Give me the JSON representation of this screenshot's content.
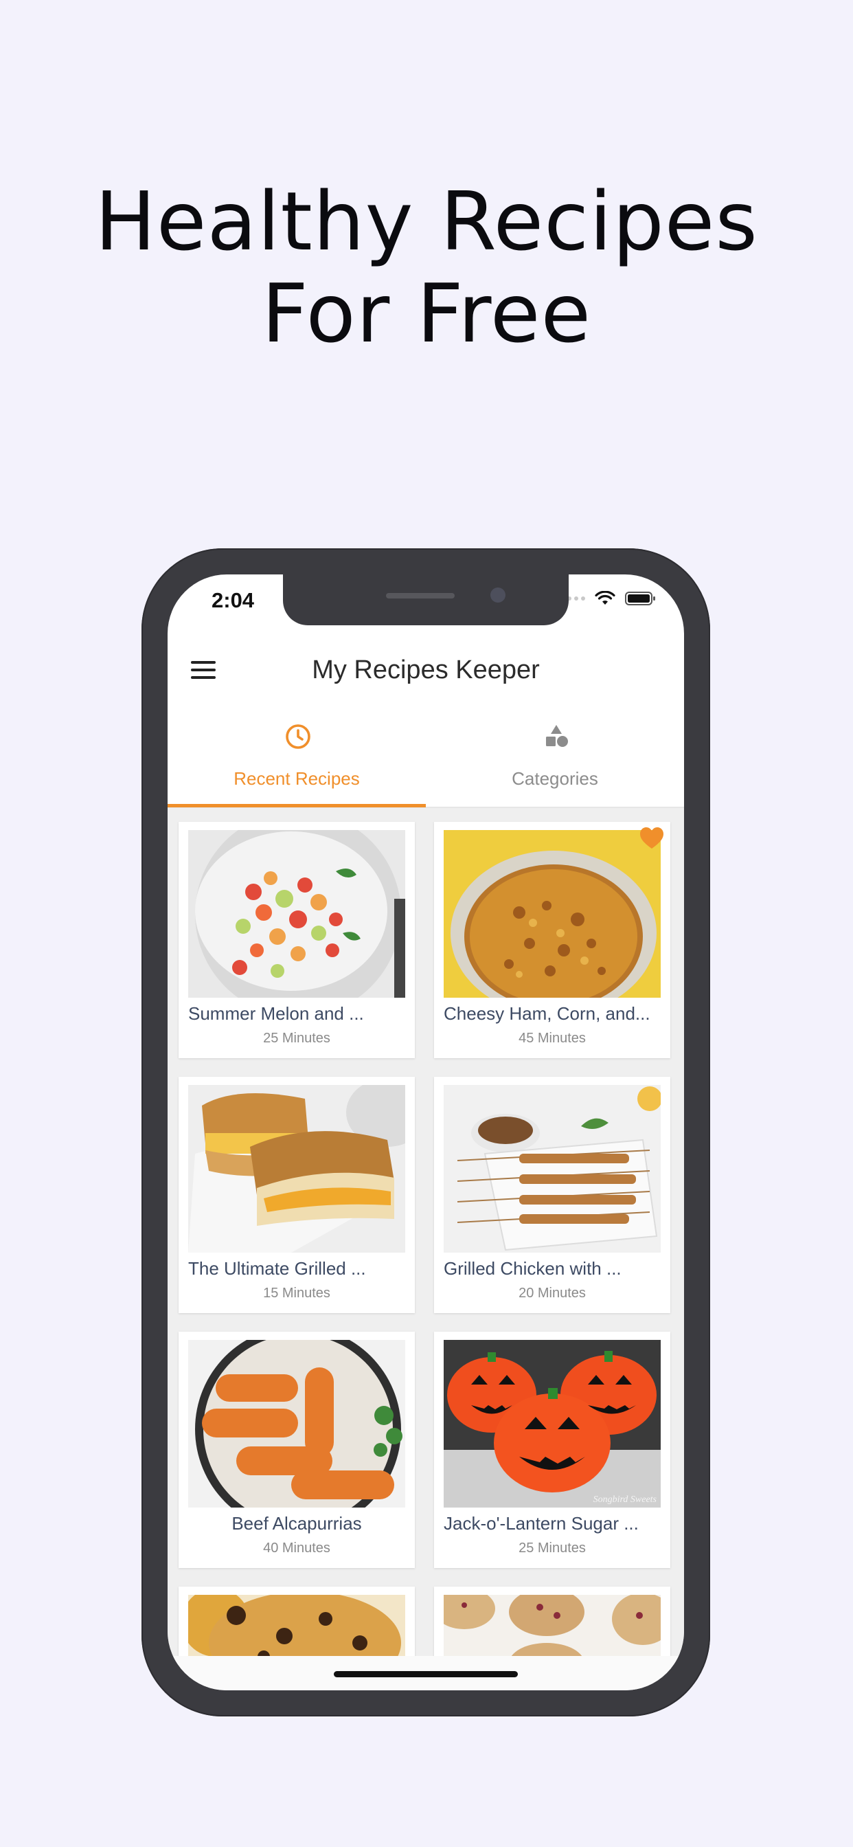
{
  "headline": {
    "line1": "Healthy Recipes",
    "line2": "For Free"
  },
  "status_bar": {
    "time": "2:04",
    "icons": [
      "signal-dots-icon",
      "wifi-icon",
      "battery-icon"
    ]
  },
  "app": {
    "title": "My Recipes Keeper",
    "menu_icon": "hamburger-menu-icon"
  },
  "tabs": [
    {
      "label": "Recent Recipes",
      "icon": "clock-icon",
      "active": true
    },
    {
      "label": "Categories",
      "icon": "shapes-icon",
      "active": false
    }
  ],
  "recipes": [
    {
      "name": "Summer Melon and ...",
      "time": "25 Minutes",
      "favorite": false
    },
    {
      "name": "Cheesy Ham, Corn, and...",
      "time": "45 Minutes",
      "favorite": true
    },
    {
      "name": "The Ultimate Grilled ...",
      "time": "15 Minutes",
      "favorite": false
    },
    {
      "name": "Grilled Chicken with ...",
      "time": "20 Minutes",
      "favorite": false
    },
    {
      "name": "Beef Alcapurrias",
      "time": "40 Minutes",
      "favorite": false
    },
    {
      "name": "Jack-o'-Lantern Sugar ...",
      "time": "25 Minutes",
      "favorite": false
    },
    {
      "name": "",
      "time": "",
      "favorite": false
    },
    {
      "name": "",
      "time": "",
      "favorite": false
    }
  ],
  "photo_watermark": "Songbird Sweets",
  "colors": {
    "accent": "#f08f2b",
    "background": "#f3f2fc",
    "phone_frame": "#3b3b40",
    "recipe_name": "#3d4a63"
  }
}
